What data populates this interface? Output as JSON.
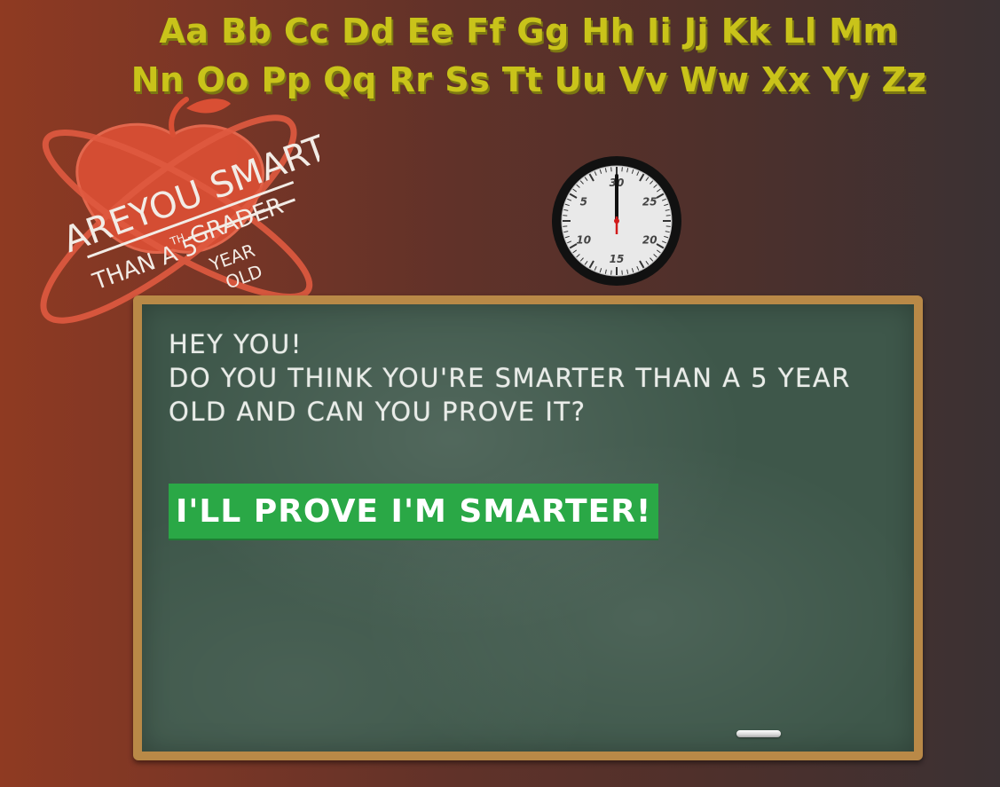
{
  "alphabet": {
    "row1": "Aa Bb Cc Dd Ee Ff Gg Hh Ii Jj Kk Ll Mm",
    "row2": "Nn Oo Pp Qq Rr Ss Tt Uu Vv Ww Xx Yy Zz"
  },
  "logo": {
    "line1": "AREYOU SMARTER",
    "line2": "THAN A 5",
    "superscript": "TH",
    "struck_word": "GRADER",
    "replacement_line1": "YEAR",
    "replacement_line2": "OLD"
  },
  "clock": {
    "labels": [
      "30",
      "25",
      "20",
      "15",
      "10",
      "5"
    ],
    "seconds_remaining": 30
  },
  "board": {
    "greeting": "Hey you!",
    "question_line1": "Do you think you're smarter than a 5 year",
    "question_line2": "old and can you prove it?",
    "button_label": "I'll prove I'm smarter!"
  },
  "colors": {
    "alphabet": "#c9c31a",
    "board": "#3e574a",
    "board_frame": "#b98947",
    "button": "#2aa846",
    "logo": "#e05a40"
  }
}
